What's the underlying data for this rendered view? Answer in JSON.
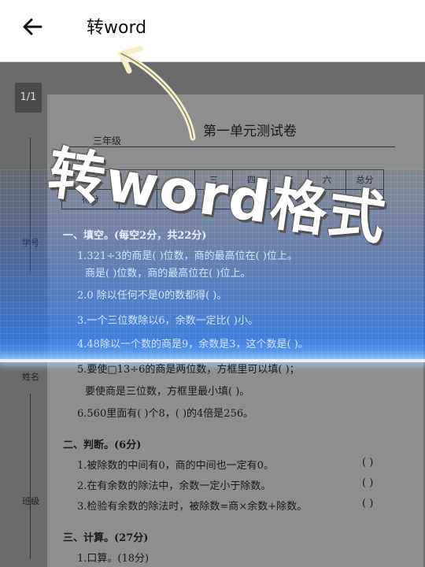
{
  "header": {
    "title": "转word"
  },
  "viewer": {
    "page_indicator": "1/1"
  },
  "document": {
    "title": "第一单元测试卷",
    "grade": "三年级",
    "score_table": {
      "headers": [
        "题号",
        "一",
        "二",
        "三",
        "四",
        "五",
        "六",
        "总分"
      ],
      "row_label": "得分"
    },
    "side_labels": [
      "学号",
      "姓名",
      "班级"
    ],
    "lines": [
      {
        "kind": "section",
        "text": "一、填空。(每空2分，共22分)"
      },
      {
        "kind": "item",
        "text": "1.321÷3的商是(         )位数，商的最高位在(         )位上。"
      },
      {
        "kind": "item",
        "text": "商是(        )位数，商的最高位在(        )位上。"
      },
      {
        "kind": "item",
        "text": "2.0 除以任何不是0的数都得(         )。"
      },
      {
        "kind": "item",
        "text": "3.一个三位数除以6，余数一定比(         )小。"
      },
      {
        "kind": "item",
        "text": "4.48除以一个数的商是9，余数是3，这个数是(         )。"
      },
      {
        "kind": "item",
        "text": "5.要使□13÷6的商是两位数，方框里可以填(                              )；"
      },
      {
        "kind": "item",
        "text": "要使商是三位数，方框里最小填(         )。"
      },
      {
        "kind": "item",
        "text": "6.560里面有(          )个8，(        )的4倍是256。"
      },
      {
        "kind": "section",
        "text": "二、判断。(6分)"
      },
      {
        "kind": "item",
        "text": "1.被除数的中间有0，商的中间也一定有0。"
      },
      {
        "kind": "item",
        "text": "2.在有余数的除法中，余数一定小于除数。"
      },
      {
        "kind": "item",
        "text": "3.检验有余数的除法时，被除数=商×余数+除数。"
      },
      {
        "kind": "section",
        "text": "三、计算。(27分)"
      },
      {
        "kind": "item",
        "text": "1.口算。(18分)"
      }
    ],
    "judge_brackets": [
      "(        )",
      "(        )",
      "(        )"
    ]
  },
  "overlay": {
    "caption": "转word格式"
  },
  "colors": {
    "scan_blue": "#2d7cf0",
    "header_bg": "#ffffff",
    "viewer_bg": "#6b6b6b"
  },
  "icons": {
    "back": "back-arrow-icon",
    "annotation": "curved-arrow-icon"
  }
}
